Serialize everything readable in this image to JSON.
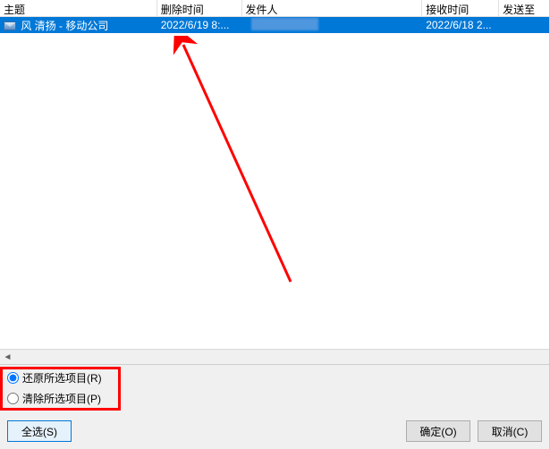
{
  "columns": {
    "subject": "主题",
    "deleted_time": "删除时间",
    "sender": "发件人",
    "received_time": "接收时间",
    "send_to": "发送至"
  },
  "row": {
    "subject": "风 清扬 - 移动公司",
    "deleted_time": "2022/6/19 8:...",
    "received_time": "2022/6/18 2..."
  },
  "options": {
    "restore": "还原所选项目(R)",
    "purge": "清除所选项目(P)"
  },
  "buttons": {
    "select_all": "全选(S)",
    "ok": "确定(O)",
    "cancel": "取消(C)"
  }
}
